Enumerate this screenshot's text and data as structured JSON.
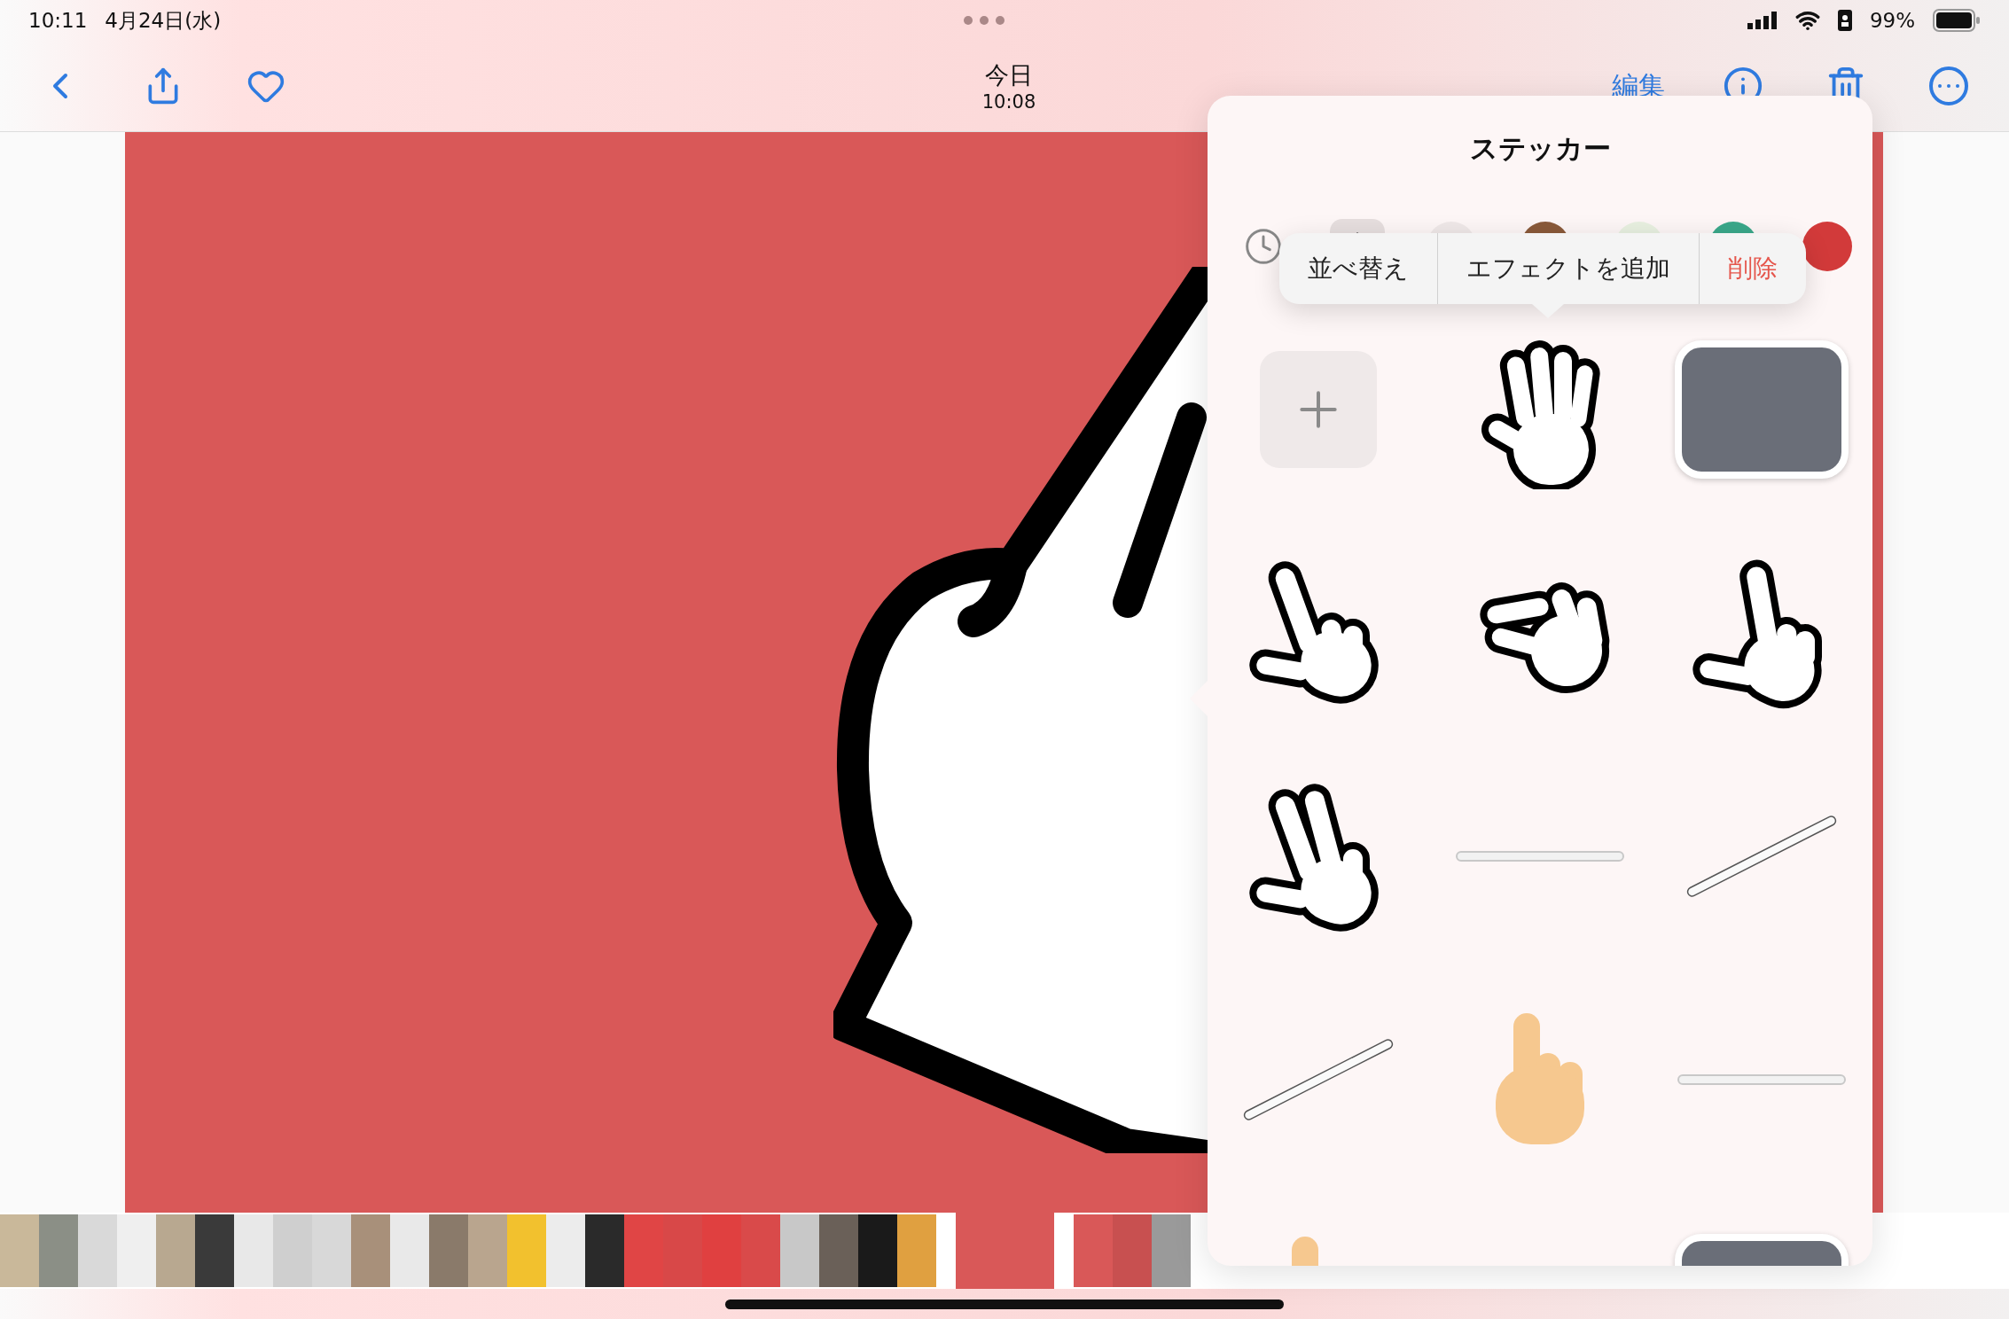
{
  "status_bar": {
    "time": "10:11",
    "date": "4月24日(水)",
    "battery": "99%"
  },
  "nav": {
    "title": "今日",
    "subtitle": "10:08",
    "edit": "編集"
  },
  "sticker_panel": {
    "title": "ステッカー",
    "tabs": [
      {
        "kind": "recent",
        "selected": false
      },
      {
        "kind": "sticker",
        "selected": true
      },
      {
        "kind": "outline",
        "selected": false
      },
      {
        "kind": "brown",
        "selected": false
      },
      {
        "kind": "leaf",
        "selected": false
      },
      {
        "kind": "green",
        "selected": false
      },
      {
        "kind": "dog",
        "selected": false
      }
    ],
    "context_menu": [
      {
        "label": "並べ替え",
        "destructive": false
      },
      {
        "label": "エフェクトを追加",
        "destructive": false
      },
      {
        "label": "削除",
        "destructive": true
      }
    ],
    "stickers": [
      {
        "kind": "add"
      },
      {
        "kind": "open-hand"
      },
      {
        "kind": "photo"
      },
      {
        "kind": "pointing-hand"
      },
      {
        "kind": "pinch-hand"
      },
      {
        "kind": "pointing-hand-left"
      },
      {
        "kind": "two-finger-hand"
      },
      {
        "kind": "pencil-flat"
      },
      {
        "kind": "pencil-diagonal"
      },
      {
        "kind": "pencil-diagonal"
      },
      {
        "kind": "emoji-hand"
      },
      {
        "kind": "pencil-flat"
      },
      {
        "kind": "emoji-hand"
      },
      {
        "kind": "empty"
      },
      {
        "kind": "photo"
      }
    ]
  },
  "filmstrip": [
    {
      "selected": false
    },
    {
      "selected": false
    },
    {
      "selected": false
    },
    {
      "selected": false
    },
    {
      "selected": false
    },
    {
      "selected": false
    },
    {
      "selected": false
    },
    {
      "selected": false
    },
    {
      "selected": false
    },
    {
      "selected": false
    },
    {
      "selected": false
    },
    {
      "selected": false
    },
    {
      "selected": false
    },
    {
      "selected": false
    },
    {
      "selected": false
    },
    {
      "selected": false
    },
    {
      "selected": false
    },
    {
      "selected": false
    },
    {
      "selected": false
    },
    {
      "selected": false
    },
    {
      "selected": false
    },
    {
      "selected": false
    },
    {
      "selected": false
    },
    {
      "selected": false
    },
    {
      "selected": true
    },
    {
      "selected": false
    },
    {
      "selected": false
    },
    {
      "selected": false
    }
  ]
}
